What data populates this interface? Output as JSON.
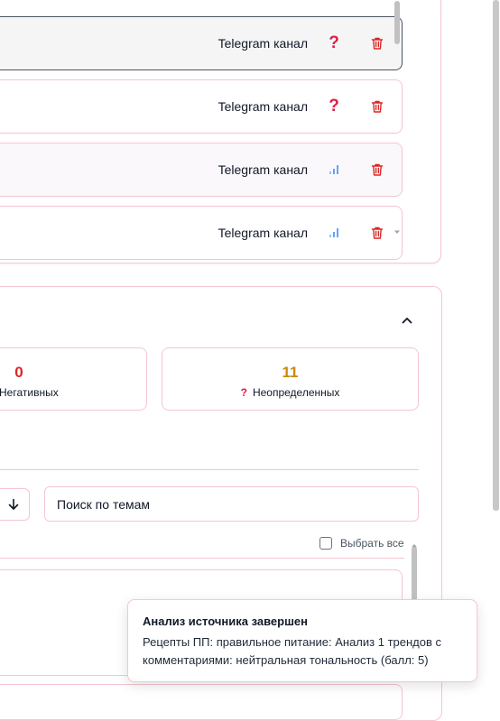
{
  "sources": {
    "rows": [
      {
        "type": "Telegram канал",
        "status_icon": "question-icon"
      },
      {
        "type": "Telegram канал",
        "status_icon": "question-icon"
      },
      {
        "type": "Telegram канал",
        "status_icon": "bar-chart-icon"
      },
      {
        "type": "Telegram канал",
        "status_icon": "bar-chart-icon"
      }
    ]
  },
  "analysis": {
    "stats": {
      "negative": {
        "value": "0",
        "label": "Негативных"
      },
      "undefined": {
        "value": "11",
        "label": "Неопределенных"
      }
    },
    "search": {
      "placeholder": "Поиск по темам"
    },
    "select_all_label": "Выбрать все"
  },
  "toast": {
    "title": "Анализ источника завершен",
    "body": "Рецепты ПП: правильное питание: Анализ 1 трендов с комментариями: нейтральная тональность (балл: 5)"
  },
  "colors": {
    "border_pink": "#f5c6d0",
    "negative": "#dc2626",
    "undefined": "#ca8a04",
    "question": "#e11d48",
    "chart_blue": "#60a5fa",
    "delete_red": "#dc2626"
  }
}
